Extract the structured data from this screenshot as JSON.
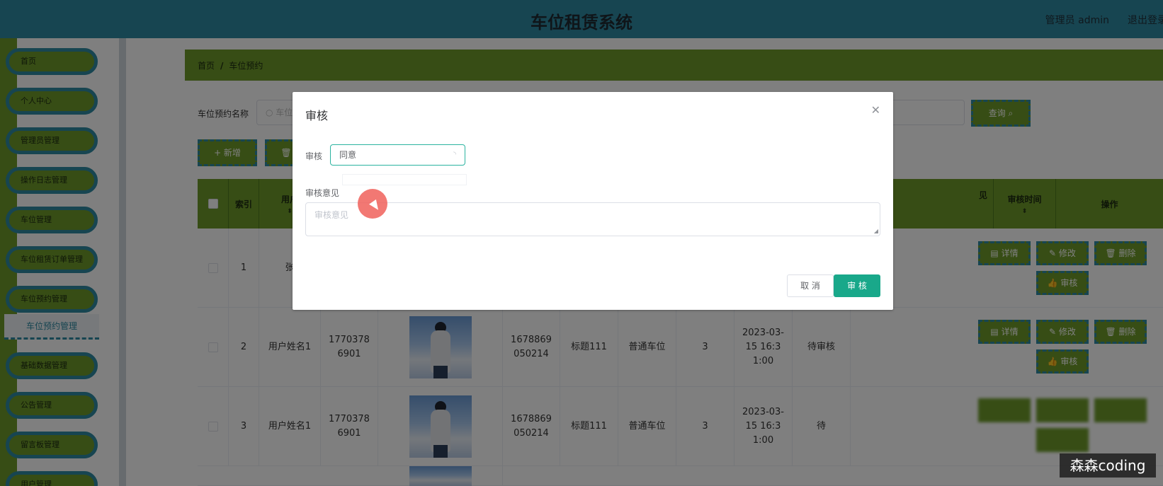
{
  "header": {
    "title": "车位租赁系统",
    "user": "管理员 admin",
    "logout": "退出登录"
  },
  "sidebar": {
    "items": [
      {
        "label": "首页"
      },
      {
        "label": "个人中心"
      },
      {
        "label": "管理员管理"
      },
      {
        "label": "操作日志管理"
      },
      {
        "label": "车位管理"
      },
      {
        "label": "车位租赁订单管理"
      },
      {
        "label": "车位预约管理"
      },
      {
        "label": "基础数据管理"
      },
      {
        "label": "公告管理"
      },
      {
        "label": "留言板管理"
      },
      {
        "label": "用户管理"
      }
    ],
    "active_sub": "车位预约管理"
  },
  "breadcrumb": {
    "home": "首页",
    "sep": "/",
    "current": "车位预约"
  },
  "search": {
    "label": "车位预约名称",
    "placeholder": "车位",
    "query_label": "查询"
  },
  "toolbar": {
    "add_label": "+ 新增",
    "delete_label": "🗑"
  },
  "table": {
    "headers": [
      "索引",
      "用户",
      "审核时间",
      "操作",
      "见"
    ],
    "rows": [
      {
        "index": "1",
        "name": "张",
        "phone": "",
        "num": "",
        "title": "",
        "type": "",
        "qty": "",
        "time": "",
        "status": ""
      },
      {
        "index": "2",
        "name": "用户姓名1",
        "phone": "17703786901",
        "num": "1678869050214",
        "title": "标题111",
        "type": "普通车位",
        "qty": "3",
        "time": "2023-03-15 16:31:00",
        "status": "待审核"
      },
      {
        "index": "3",
        "name": "用户姓名1",
        "phone": "17703786901",
        "num": "1678869050214",
        "title": "标题111",
        "type": "普通车位",
        "qty": "3",
        "time": "2023-03-15 16:31:00",
        "status": "待"
      }
    ],
    "ops": {
      "detail": "详情",
      "edit": "修改",
      "delete": "删除",
      "audit": "审核"
    }
  },
  "dialog": {
    "title": "审核",
    "field1_label": "审核",
    "field1_value": "同意",
    "field2_label": "审核意见",
    "field2_placeholder": "审核意见",
    "cancel_label": "取 消",
    "confirm_label": "审 核"
  },
  "watermark": "森森coding"
}
